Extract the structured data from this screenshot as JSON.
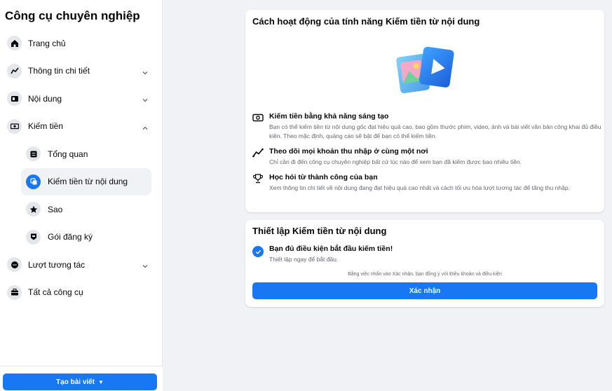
{
  "sidebar": {
    "title": "Công cụ chuyên nghiệp",
    "items": [
      {
        "label": "Trang chủ",
        "icon": "home-icon"
      },
      {
        "label": "Thông tin chi tiết",
        "icon": "insights-icon"
      },
      {
        "label": "Nội dung",
        "icon": "content-icon"
      },
      {
        "label": "Kiếm tiền",
        "icon": "money-icon"
      },
      {
        "label": "Tổng quan",
        "icon": "overview-icon"
      },
      {
        "label": "Kiếm tiền từ nội dung",
        "icon": "content-monetization-icon"
      },
      {
        "label": "Sao",
        "icon": "stars-icon"
      },
      {
        "label": "Gói đăng ký",
        "icon": "subscription-icon"
      },
      {
        "label": "Lượt tương tác",
        "icon": "engagement-icon"
      },
      {
        "label": "Tất cả công cụ",
        "icon": "toolbox-icon"
      }
    ],
    "create_button": "Tạo bài viết"
  },
  "how_it_works": {
    "title": "Cách hoạt động của tính năng Kiếm tiền từ nội dung",
    "features": [
      {
        "title": "Kiếm tiền bằng khả năng sáng tạo",
        "desc": "Bạn có thể kiếm tiền từ nội dung gốc đạt hiệu quả cao, bao gồm thước phim, video, ảnh và bài viết văn bản công khai đủ điều kiện. Theo mặc định, quảng cáo sẽ bật để bạn có thể kiếm tiền."
      },
      {
        "title": "Theo dõi mọi khoản thu nhập ở cùng một nơi",
        "desc": "Chỉ cần đi đến công cụ chuyên nghiệp bất cứ lúc nào để xem bạn đã kiếm được bao nhiêu tiền."
      },
      {
        "title": "Học hỏi từ thành công của bạn",
        "desc": "Xem thông tin chi tiết về nội dung đang đạt hiệu quả cao nhất và cách tối ưu hóa lượt tương tác để tăng thu nhập."
      }
    ]
  },
  "setup": {
    "title": "Thiết lập Kiếm tiền từ nội dung",
    "eligible_title": "Bạn đủ điều kiện bắt đầu kiếm tiền!",
    "eligible_sub": "Thiết lập ngay để bắt đầu.",
    "terms": "Bằng việc nhấn vào Xác nhận, bạn đồng ý với Điều khoản và điều kiện",
    "confirm_button": "Xác nhận"
  },
  "colors": {
    "accent": "#1877f2",
    "background": "#f0f2f5"
  }
}
